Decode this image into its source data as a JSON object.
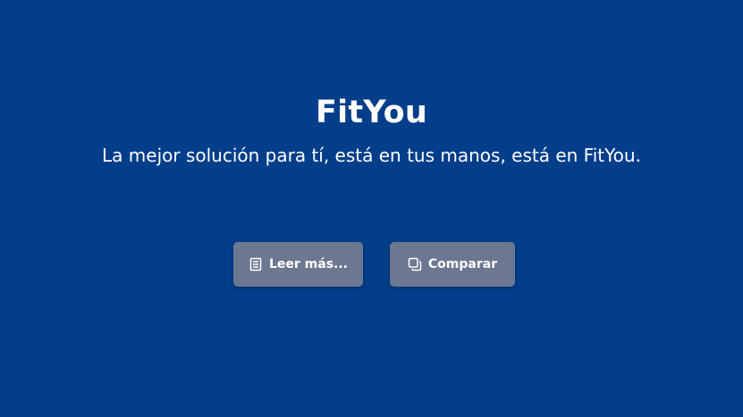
{
  "hero": {
    "title": "FitYou",
    "subtitle": "La mejor solución para tí, está en tus manos, está en FitYou."
  },
  "actions": {
    "read_more": {
      "label": "Leer más...",
      "icon": "document-icon"
    },
    "compare": {
      "label": "Comparar",
      "icon": "copy-icon"
    }
  },
  "colors": {
    "background": "#023e8a",
    "button": "#6c7891",
    "text": "#ffffff"
  }
}
